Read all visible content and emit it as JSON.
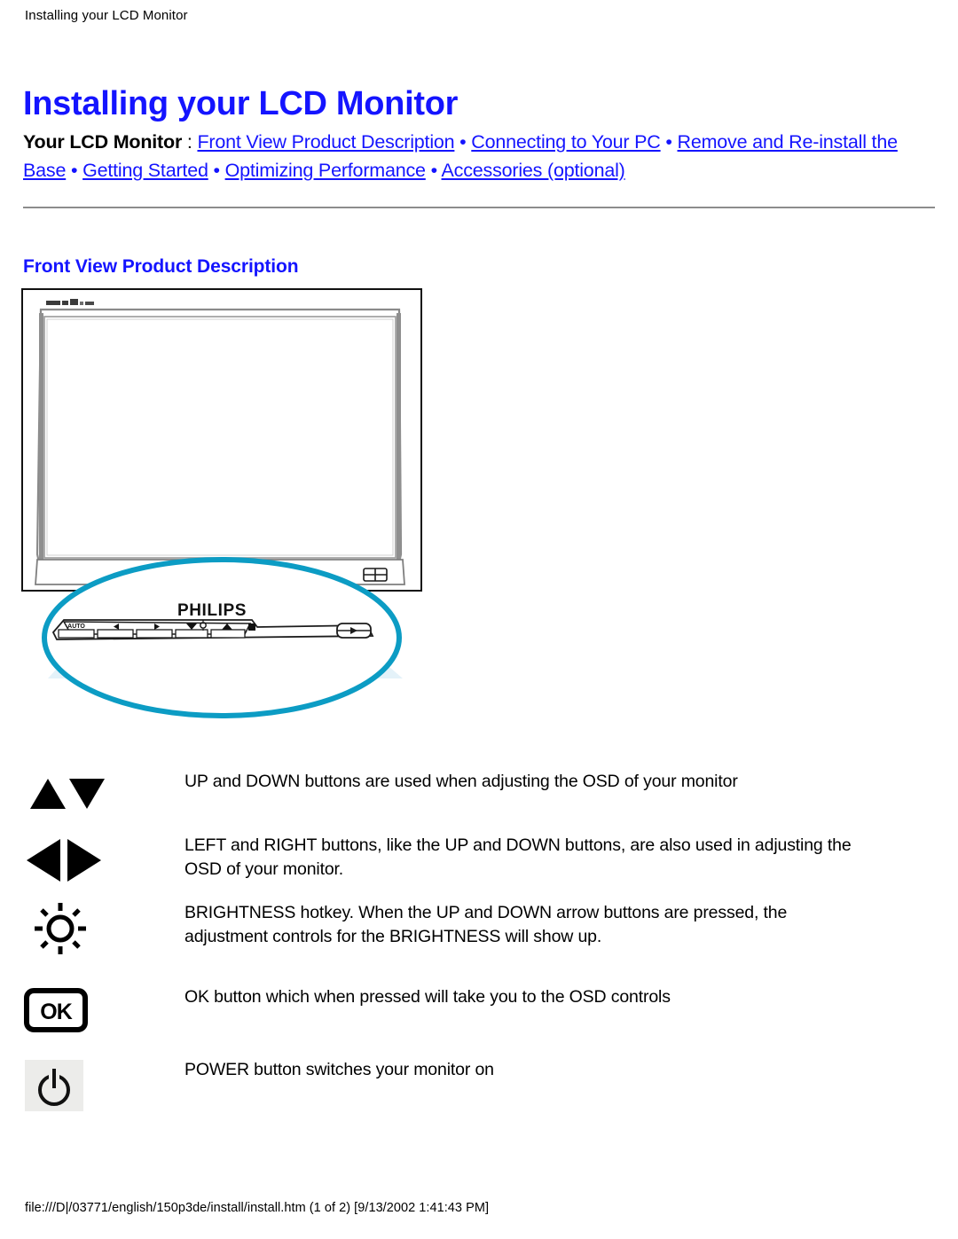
{
  "header": {
    "running_title": "Installing your LCD Monitor"
  },
  "title": "Installing your LCD Monitor",
  "nav": {
    "lead": "Your LCD Monitor",
    "colon": " : ",
    "separator": " • ",
    "links": [
      "Front View Product Description",
      "Connecting to Your PC",
      "Remove and Re-install the Base",
      "Getting Started",
      "Optimizing Performance",
      "Accessories (optional)"
    ]
  },
  "section": {
    "heading": "Front View Product Description"
  },
  "figure": {
    "brand": "PHILIPS",
    "auto_label": "AUTO",
    "alt": "Philips LCD monitor front view with magnified control panel callout",
    "callout_color": "#0c9cc4",
    "beam_color": "#cfeaf4"
  },
  "legend": [
    {
      "icon": "up-down-arrows-icon",
      "text": "UP and DOWN buttons are used when adjusting the OSD of your monitor"
    },
    {
      "icon": "left-right-arrows-icon",
      "text": "LEFT and RIGHT buttons, like the UP and DOWN buttons, are also used in adjusting the OSD of your monitor."
    },
    {
      "icon": "brightness-icon",
      "text": "BRIGHTNESS hotkey. When the UP and DOWN arrow buttons are pressed, the adjustment controls for the BRIGHTNESS will show up."
    },
    {
      "icon": "ok-button-icon",
      "text": "OK button which when pressed will take you to the OSD controls"
    },
    {
      "icon": "power-button-icon",
      "text": "POWER button switches your monitor on"
    }
  ],
  "footer": {
    "path": "file:///D|/03771/english/150p3de/install/install.htm (1 of 2) [9/13/2002 1:41:43 PM]"
  },
  "colors": {
    "link_blue": "#1414ff",
    "heading_blue": "#1414ff",
    "rule_gray": "#9a9a9a",
    "callout_cyan": "#0c9cc4"
  }
}
